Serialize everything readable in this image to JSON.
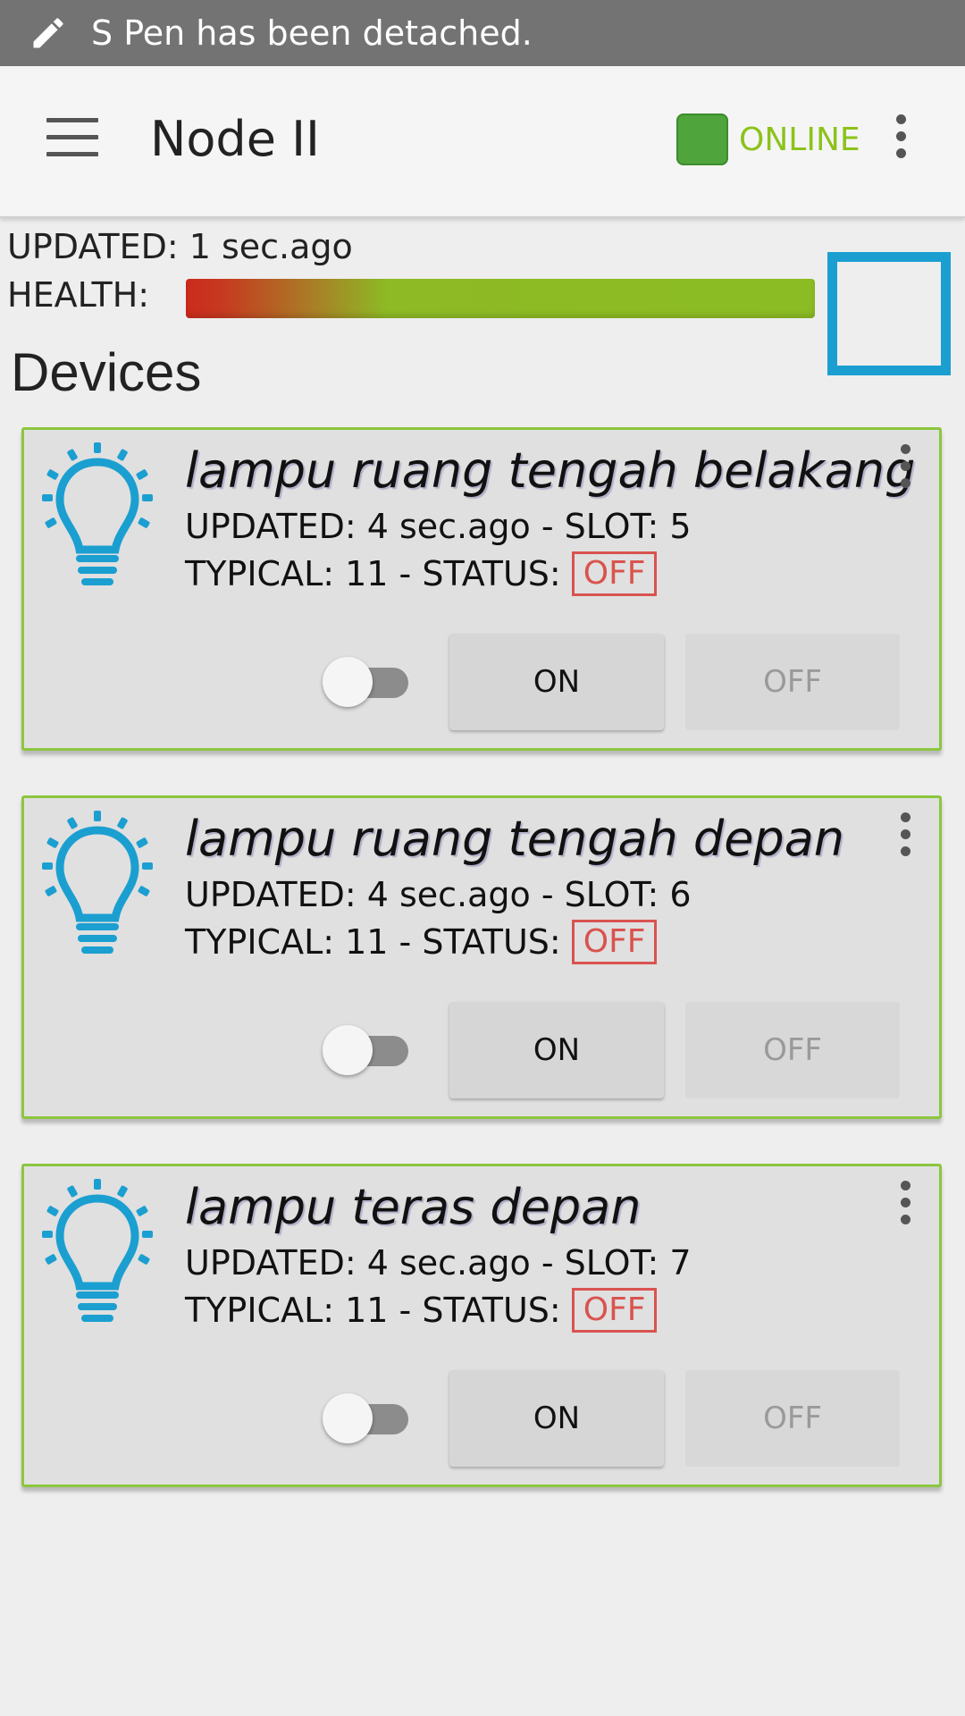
{
  "notification": {
    "icon": "pen-icon",
    "text": "S Pen has been detached."
  },
  "app_bar": {
    "menu_icon": "hamburger-menu-icon",
    "title": "Node II",
    "status_color": "#4fa53c",
    "status_label": "ONLINE",
    "status_label_color": "#8cc21b",
    "overflow_icon": "more-vert-icon"
  },
  "info": {
    "updated": "UPDATED: 1 sec.ago",
    "health_label": "HEALTH:",
    "health_level": 0.95
  },
  "devices_heading": "Devices",
  "devices": [
    {
      "name": "lampu ruang tengah belakang",
      "icon": "lightbulb-icon",
      "updated_line": "UPDATED: 4 sec.ago - SLOT: 5",
      "typical_line": "TYPICAL: 11 - STATUS:",
      "status": "OFF",
      "toggle_on": false,
      "on_label": "ON",
      "off_label": "OFF"
    },
    {
      "name": "lampu ruang tengah depan",
      "icon": "lightbulb-icon",
      "updated_line": "UPDATED: 4 sec.ago - SLOT: 6",
      "typical_line": "TYPICAL: 11 - STATUS:",
      "status": "OFF",
      "toggle_on": false,
      "on_label": "ON",
      "off_label": "OFF"
    },
    {
      "name": "lampu teras depan",
      "icon": "lightbulb-icon",
      "updated_line": "UPDATED: 4 sec.ago - SLOT: 7",
      "typical_line": "TYPICAL: 11 - STATUS:",
      "status": "OFF",
      "toggle_on": false,
      "on_label": "ON",
      "off_label": "OFF"
    }
  ],
  "colors": {
    "accent_blue": "#1b9fd0",
    "card_border": "#8cc63f",
    "status_off": "#d9534f"
  }
}
